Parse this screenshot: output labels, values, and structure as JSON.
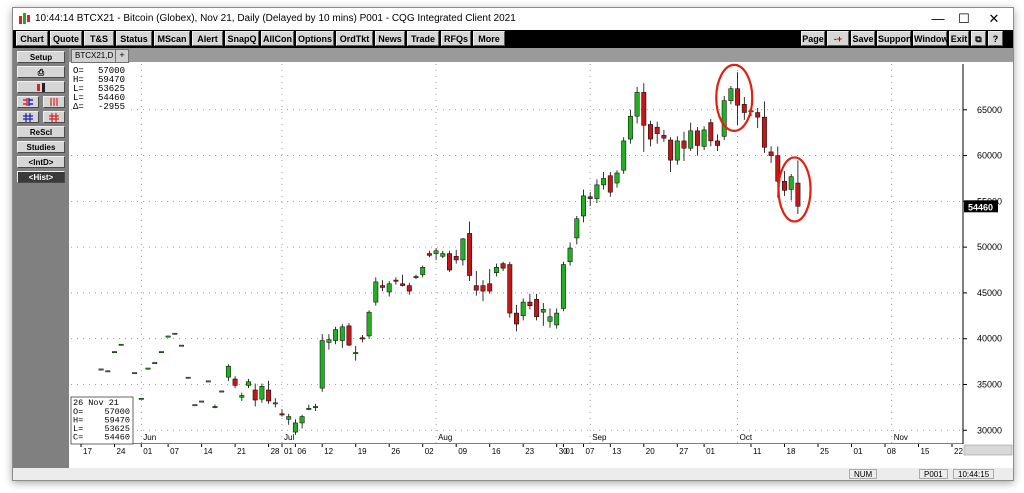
{
  "window": {
    "title": "10:44:14  BTCX21 - Bitcoin (Globex), Nov 21, Daily (Delayed by 10 mins)   P001 - CQG Integrated Client 2021",
    "minimize": "—",
    "maximize": "☐",
    "close": "✕"
  },
  "toolbar": {
    "left": [
      "Chart",
      "Quote",
      "T&S",
      "Status",
      "MScan",
      "Alert",
      "SnapQ",
      "AllCon",
      "Options",
      "OrdTkt",
      "News",
      "Trade",
      "RFQs",
      "More"
    ],
    "right": [
      "Page",
      "Save",
      "Support",
      "Window",
      "Exit",
      "⧉",
      "?"
    ],
    "arrow_label": "-+"
  },
  "left_panel": {
    "setup": "Setup",
    "print": "⎙",
    "rescl": "ReScl",
    "studies": "Studies",
    "intd": "<IntD>",
    "hist": "<Hist>"
  },
  "tab": {
    "label": "BTCX21,D",
    "plus": "+"
  },
  "ohlc_top": {
    "rows": [
      {
        "k": "O=",
        "v": "57000"
      },
      {
        "k": "H=",
        "v": "59470"
      },
      {
        "k": "L=",
        "v": "53625"
      },
      {
        "k": "L=",
        "v": "54460"
      },
      {
        "k": "Δ=",
        "v": "-2955"
      }
    ]
  },
  "ohlc_bottom": {
    "date": "26  Nov  21",
    "rows": [
      {
        "k": "O=",
        "v": "57000"
      },
      {
        "k": "H=",
        "v": "59470"
      },
      {
        "k": "L=",
        "v": "53625"
      },
      {
        "k": "C=",
        "v": "54460"
      }
    ]
  },
  "status": {
    "num": "NUM",
    "page": "P001",
    "time": "10:44:15"
  },
  "chart_data": {
    "type": "candlestick",
    "symbol": "BTCX21",
    "ylim": [
      28500,
      70000
    ],
    "yticks": [
      30000,
      35000,
      40000,
      45000,
      50000,
      55000,
      60000,
      65000
    ],
    "last_price_label": "54460",
    "grid": true,
    "months": [
      {
        "label": "Jun",
        "at": 9
      },
      {
        "label": "Jul",
        "at": 30
      },
      {
        "label": "Aug",
        "at": 53
      },
      {
        "label": "Sep",
        "at": 76
      },
      {
        "label": "Oct",
        "at": 98
      },
      {
        "label": "Nov",
        "at": 121
      }
    ],
    "days": [
      {
        "label": "17",
        "at": 0
      },
      {
        "label": "24",
        "at": 5
      },
      {
        "label": "01",
        "at": 9
      },
      {
        "label": "07",
        "at": 13
      },
      {
        "label": "14",
        "at": 18
      },
      {
        "label": "21",
        "at": 23
      },
      {
        "label": "28",
        "at": 28
      },
      {
        "label": "01",
        "at": 30
      },
      {
        "label": "06",
        "at": 32
      },
      {
        "label": "12",
        "at": 36
      },
      {
        "label": "19",
        "at": 41
      },
      {
        "label": "26",
        "at": 46
      },
      {
        "label": "02",
        "at": 51
      },
      {
        "label": "09",
        "at": 56
      },
      {
        "label": "16",
        "at": 61
      },
      {
        "label": "23",
        "at": 66
      },
      {
        "label": "30",
        "at": 71
      },
      {
        "label": "01",
        "at": 72
      },
      {
        "label": "07",
        "at": 75
      },
      {
        "label": "13",
        "at": 79
      },
      {
        "label": "20",
        "at": 84
      },
      {
        "label": "27",
        "at": 89
      },
      {
        "label": "01",
        "at": 93
      },
      {
        "label": "11",
        "at": 100
      },
      {
        "label": "18",
        "at": 105
      },
      {
        "label": "25",
        "at": 110
      },
      {
        "label": "01",
        "at": 115
      },
      {
        "label": "08",
        "at": 120
      },
      {
        "label": "15",
        "at": 125
      },
      {
        "label": "22",
        "at": 130
      }
    ],
    "candles": [
      {
        "x": 3,
        "o": 36700,
        "h": 36700,
        "l": 36700,
        "c": 36700
      },
      {
        "x": 4,
        "o": 36500,
        "h": 36500,
        "l": 36500,
        "c": 36500
      },
      {
        "x": 5,
        "o": 38600,
        "h": 38600,
        "l": 38600,
        "c": 38600
      },
      {
        "x": 6,
        "o": 39400,
        "h": 39400,
        "l": 39400,
        "c": 39400
      },
      {
        "x": 8,
        "o": 36300,
        "h": 36300,
        "l": 36300,
        "c": 36300
      },
      {
        "x": 9,
        "o": 33500,
        "h": 33500,
        "l": 33500,
        "c": 33500
      },
      {
        "x": 10,
        "o": 36800,
        "h": 36800,
        "l": 36800,
        "c": 36800
      },
      {
        "x": 11,
        "o": 37400,
        "h": 37400,
        "l": 37400,
        "c": 37400
      },
      {
        "x": 12,
        "o": 38600,
        "h": 38600,
        "l": 38600,
        "c": 38600
      },
      {
        "x": 13,
        "o": 40300,
        "h": 40300,
        "l": 40300,
        "c": 40300
      },
      {
        "x": 14,
        "o": 40600,
        "h": 40600,
        "l": 40600,
        "c": 40600
      },
      {
        "x": 15,
        "o": 39300,
        "h": 39300,
        "l": 39300,
        "c": 39300
      },
      {
        "x": 16,
        "o": 35800,
        "h": 35800,
        "l": 35800,
        "c": 35800
      },
      {
        "x": 17,
        "o": 32800,
        "h": 32800,
        "l": 32800,
        "c": 32800
      },
      {
        "x": 18,
        "o": 33200,
        "h": 33200,
        "l": 33200,
        "c": 33200
      },
      {
        "x": 19,
        "o": 35400,
        "h": 35400,
        "l": 35400,
        "c": 35400
      },
      {
        "x": 20,
        "o": 32600,
        "h": 32800,
        "l": 32400,
        "c": 32600
      },
      {
        "x": 21,
        "o": 34300,
        "h": 34300,
        "l": 34300,
        "c": 34300
      },
      {
        "x": 22,
        "o": 35800,
        "h": 37200,
        "l": 35400,
        "c": 37000
      },
      {
        "x": 23,
        "o": 35600,
        "h": 35900,
        "l": 34600,
        "c": 34900
      },
      {
        "x": 24,
        "o": 33600,
        "h": 34100,
        "l": 33200,
        "c": 33800
      },
      {
        "x": 25,
        "o": 34900,
        "h": 35600,
        "l": 34600,
        "c": 35300
      },
      {
        "x": 26,
        "o": 34400,
        "h": 35100,
        "l": 32600,
        "c": 33300
      },
      {
        "x": 27,
        "o": 33400,
        "h": 35100,
        "l": 33000,
        "c": 34800
      },
      {
        "x": 28,
        "o": 34400,
        "h": 35400,
        "l": 32900,
        "c": 33200
      },
      {
        "x": 29,
        "o": 32900,
        "h": 33500,
        "l": 32500,
        "c": 33000
      },
      {
        "x": 30,
        "o": 31800,
        "h": 32300,
        "l": 31500,
        "c": 31700
      },
      {
        "x": 31,
        "o": 31200,
        "h": 31800,
        "l": 30600,
        "c": 31500
      },
      {
        "x": 32,
        "o": 29800,
        "h": 31200,
        "l": 29500,
        "c": 30800
      },
      {
        "x": 33,
        "o": 30800,
        "h": 31700,
        "l": 30200,
        "c": 31500
      },
      {
        "x": 34,
        "o": 32400,
        "h": 32800,
        "l": 32200,
        "c": 32400
      },
      {
        "x": 35,
        "o": 32500,
        "h": 32900,
        "l": 32100,
        "c": 32600
      },
      {
        "x": 36,
        "o": 34600,
        "h": 40500,
        "l": 34200,
        "c": 39800
      },
      {
        "x": 37,
        "o": 39600,
        "h": 40500,
        "l": 38800,
        "c": 39900
      },
      {
        "x": 38,
        "o": 39800,
        "h": 41300,
        "l": 39400,
        "c": 41000
      },
      {
        "x": 39,
        "o": 39800,
        "h": 41600,
        "l": 39000,
        "c": 41300
      },
      {
        "x": 40,
        "o": 41400,
        "h": 41700,
        "l": 39200,
        "c": 39300
      },
      {
        "x": 41,
        "o": 38400,
        "h": 39200,
        "l": 37600,
        "c": 38500
      },
      {
        "x": 42,
        "o": 40100,
        "h": 40400,
        "l": 39600,
        "c": 40000
      },
      {
        "x": 43,
        "o": 40300,
        "h": 43100,
        "l": 40000,
        "c": 42900
      },
      {
        "x": 44,
        "o": 44000,
        "h": 46700,
        "l": 43600,
        "c": 46200
      },
      {
        "x": 45,
        "o": 45800,
        "h": 46400,
        "l": 45200,
        "c": 45600
      },
      {
        "x": 46,
        "o": 45100,
        "h": 46300,
        "l": 44600,
        "c": 46000
      },
      {
        "x": 47,
        "o": 46400,
        "h": 46700,
        "l": 45900,
        "c": 46300
      },
      {
        "x": 48,
        "o": 46000,
        "h": 47000,
        "l": 45700,
        "c": 45800
      },
      {
        "x": 49,
        "o": 45800,
        "h": 46100,
        "l": 44800,
        "c": 45200
      },
      {
        "x": 50,
        "o": 46700,
        "h": 47000,
        "l": 46500,
        "c": 46800
      },
      {
        "x": 51,
        "o": 47000,
        "h": 48000,
        "l": 46700,
        "c": 47800
      },
      {
        "x": 52,
        "o": 49300,
        "h": 49600,
        "l": 48900,
        "c": 49100
      },
      {
        "x": 53,
        "o": 49300,
        "h": 49900,
        "l": 48600,
        "c": 49600
      },
      {
        "x": 54,
        "o": 49000,
        "h": 49600,
        "l": 48800,
        "c": 49300
      },
      {
        "x": 55,
        "o": 49300,
        "h": 49600,
        "l": 47300,
        "c": 47500
      },
      {
        "x": 56,
        "o": 49000,
        "h": 49700,
        "l": 48200,
        "c": 48600
      },
      {
        "x": 57,
        "o": 48600,
        "h": 51000,
        "l": 48000,
        "c": 50900
      },
      {
        "x": 58,
        "o": 51500,
        "h": 52800,
        "l": 46300,
        "c": 46900
      },
      {
        "x": 59,
        "o": 45800,
        "h": 47400,
        "l": 44700,
        "c": 45300
      },
      {
        "x": 60,
        "o": 45800,
        "h": 46400,
        "l": 44100,
        "c": 45200
      },
      {
        "x": 61,
        "o": 46000,
        "h": 47600,
        "l": 44900,
        "c": 45200
      },
      {
        "x": 62,
        "o": 47200,
        "h": 48200,
        "l": 46800,
        "c": 47800
      },
      {
        "x": 63,
        "o": 48200,
        "h": 48400,
        "l": 47400,
        "c": 47700
      },
      {
        "x": 64,
        "o": 48100,
        "h": 48400,
        "l": 42300,
        "c": 42800
      },
      {
        "x": 65,
        "o": 42800,
        "h": 43700,
        "l": 40800,
        "c": 41600
      },
      {
        "x": 66,
        "o": 42500,
        "h": 44400,
        "l": 42000,
        "c": 44000
      },
      {
        "x": 67,
        "o": 44000,
        "h": 44900,
        "l": 43200,
        "c": 43600
      },
      {
        "x": 68,
        "o": 44300,
        "h": 44900,
        "l": 42000,
        "c": 42400
      },
      {
        "x": 69,
        "o": 42900,
        "h": 43900,
        "l": 41400,
        "c": 43200
      },
      {
        "x": 70,
        "o": 41900,
        "h": 43300,
        "l": 41200,
        "c": 42400
      },
      {
        "x": 71,
        "o": 41500,
        "h": 43300,
        "l": 41100,
        "c": 42800
      },
      {
        "x": 72,
        "o": 43300,
        "h": 48400,
        "l": 43000,
        "c": 48100
      },
      {
        "x": 73,
        "o": 48400,
        "h": 50500,
        "l": 48000,
        "c": 49900
      },
      {
        "x": 74,
        "o": 51000,
        "h": 53400,
        "l": 50300,
        "c": 53100
      },
      {
        "x": 75,
        "o": 53400,
        "h": 56300,
        "l": 52700,
        "c": 55600
      },
      {
        "x": 76,
        "o": 55500,
        "h": 56000,
        "l": 54500,
        "c": 55300
      },
      {
        "x": 77,
        "o": 55300,
        "h": 57400,
        "l": 54800,
        "c": 56800
      },
      {
        "x": 78,
        "o": 56800,
        "h": 58200,
        "l": 56300,
        "c": 57500
      },
      {
        "x": 79,
        "o": 57800,
        "h": 58200,
        "l": 55500,
        "c": 56000
      },
      {
        "x": 80,
        "o": 57000,
        "h": 58400,
        "l": 56500,
        "c": 58100
      },
      {
        "x": 81,
        "o": 58400,
        "h": 62000,
        "l": 58000,
        "c": 61600
      },
      {
        "x": 82,
        "o": 61800,
        "h": 65000,
        "l": 61300,
        "c": 64300
      },
      {
        "x": 83,
        "o": 64300,
        "h": 67500,
        "l": 63500,
        "c": 66900
      },
      {
        "x": 84,
        "o": 66900,
        "h": 67900,
        "l": 60400,
        "c": 63300
      },
      {
        "x": 85,
        "o": 63400,
        "h": 63800,
        "l": 61000,
        "c": 61800
      },
      {
        "x": 86,
        "o": 63100,
        "h": 63700,
        "l": 61300,
        "c": 62400
      },
      {
        "x": 87,
        "o": 62200,
        "h": 62800,
        "l": 61500,
        "c": 61900
      },
      {
        "x": 88,
        "o": 61700,
        "h": 62000,
        "l": 58200,
        "c": 59500
      },
      {
        "x": 89,
        "o": 59500,
        "h": 62100,
        "l": 59000,
        "c": 61600
      },
      {
        "x": 90,
        "o": 61600,
        "h": 62600,
        "l": 59400,
        "c": 60800
      },
      {
        "x": 91,
        "o": 60800,
        "h": 63600,
        "l": 60500,
        "c": 62700
      },
      {
        "x": 92,
        "o": 62700,
        "h": 63100,
        "l": 60000,
        "c": 61100
      },
      {
        "x": 93,
        "o": 61000,
        "h": 63200,
        "l": 60600,
        "c": 62800
      },
      {
        "x": 94,
        "o": 63600,
        "h": 64000,
        "l": 61000,
        "c": 61600
      },
      {
        "x": 95,
        "o": 61600,
        "h": 62300,
        "l": 60500,
        "c": 61100
      },
      {
        "x": 96,
        "o": 62100,
        "h": 66500,
        "l": 61700,
        "c": 66000
      },
      {
        "x": 97,
        "o": 66000,
        "h": 67600,
        "l": 65600,
        "c": 67300
      },
      {
        "x": 98,
        "o": 67300,
        "h": 69100,
        "l": 63300,
        "c": 65500
      },
      {
        "x": 99,
        "o": 65600,
        "h": 66400,
        "l": 63900,
        "c": 64700
      },
      {
        "x": 100,
        "o": 64800,
        "h": 65400,
        "l": 64300,
        "c": 64900
      },
      {
        "x": 101,
        "o": 64700,
        "h": 65200,
        "l": 63000,
        "c": 64200
      },
      {
        "x": 102,
        "o": 64200,
        "h": 65900,
        "l": 60300,
        "c": 60900
      },
      {
        "x": 103,
        "o": 60400,
        "h": 61000,
        "l": 59200,
        "c": 60000
      },
      {
        "x": 104,
        "o": 60000,
        "h": 61000,
        "l": 55400,
        "c": 57200
      },
      {
        "x": 105,
        "o": 57200,
        "h": 58300,
        "l": 55600,
        "c": 56200
      },
      {
        "x": 106,
        "o": 56300,
        "h": 58000,
        "l": 55100,
        "c": 57700
      },
      {
        "x": 107,
        "o": 57000,
        "h": 59470,
        "l": 53625,
        "c": 54460
      }
    ]
  }
}
